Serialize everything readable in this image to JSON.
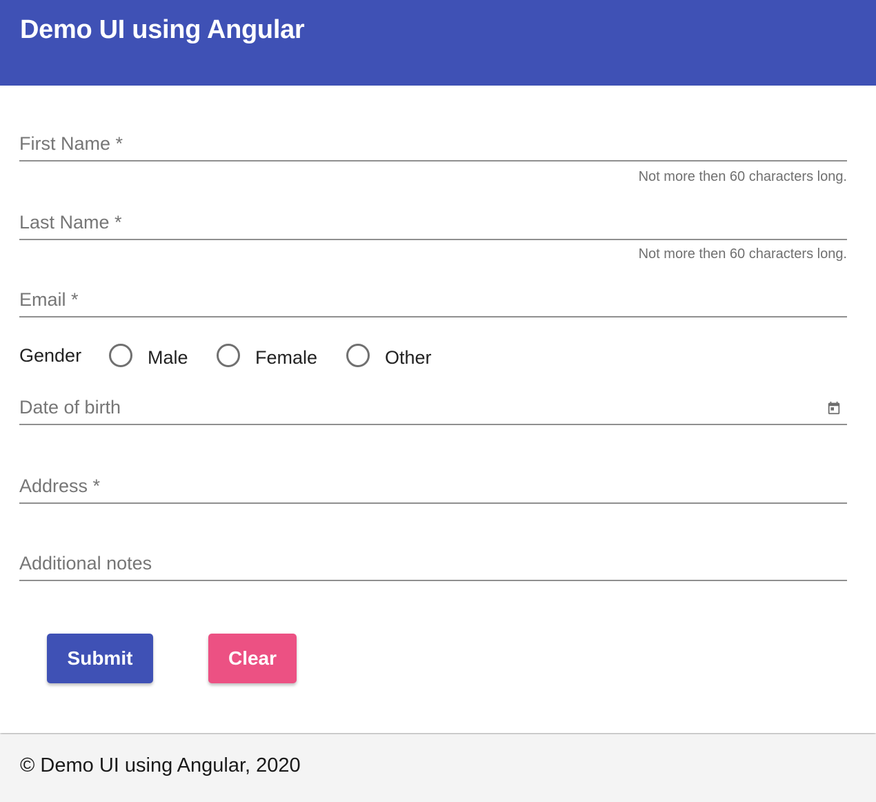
{
  "app": {
    "title": "Demo UI using Angular"
  },
  "form": {
    "first_name": {
      "label": "First Name *",
      "hint": "Not more then 60 characters long."
    },
    "last_name": {
      "label": "Last Name *",
      "hint": "Not more then 60 characters long."
    },
    "email": {
      "label": "Email *"
    },
    "gender": {
      "label": "Gender",
      "options": [
        "Male",
        "Female",
        "Other"
      ]
    },
    "dob": {
      "label": "Date of birth",
      "icon": "calendar-icon"
    },
    "address": {
      "label": "Address *"
    },
    "notes": {
      "label": "Additional notes"
    }
  },
  "actions": {
    "submit_label": "Submit",
    "clear_label": "Clear"
  },
  "footer": {
    "text": "© Demo UI using Angular, 2020"
  },
  "colors": {
    "primary": "#3f51b5",
    "accent": "#ec5183"
  }
}
